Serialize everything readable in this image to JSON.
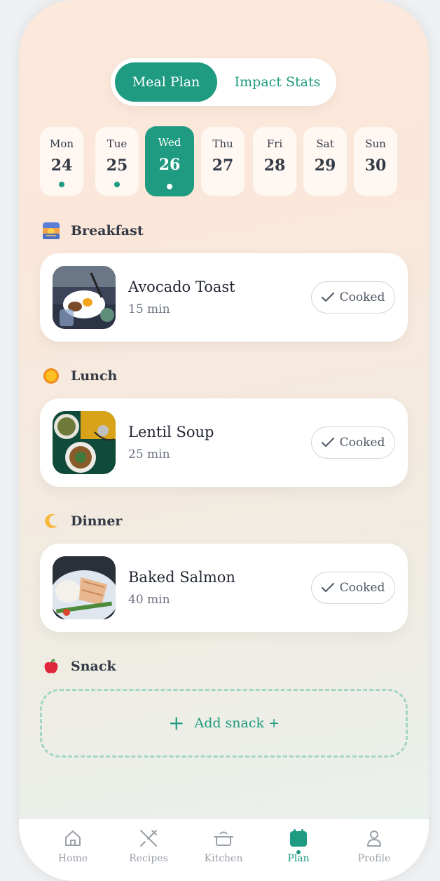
{
  "tabs": {
    "meal_plan": "Meal Plan",
    "impact_stats": "Impact Stats"
  },
  "days": [
    {
      "name": "Mon",
      "num": "24",
      "dot": true
    },
    {
      "name": "Tue",
      "num": "25",
      "dot": true
    },
    {
      "name": "Wed",
      "num": "26",
      "dot": true,
      "active": true
    },
    {
      "name": "Thu",
      "num": "27",
      "dot": false
    },
    {
      "name": "Fri",
      "num": "28",
      "dot": false
    },
    {
      "name": "Sat",
      "num": "29",
      "dot": false
    },
    {
      "name": "Sun",
      "num": "30",
      "dot": false
    }
  ],
  "sections": {
    "breakfast": {
      "label": "Breakfast",
      "icon": "sunrise-icon"
    },
    "lunch": {
      "label": "Lunch",
      "icon": "sun-icon"
    },
    "dinner": {
      "label": "Dinner",
      "icon": "crescent-moon-icon"
    },
    "snack": {
      "label": "Snack",
      "icon": "apple-icon"
    }
  },
  "meals": {
    "breakfast": {
      "name": "Avocado Toast",
      "time": "15 min",
      "action": "Cooked"
    },
    "lunch": {
      "name": "Lentil Soup",
      "time": "25 min",
      "action": "Cooked"
    },
    "dinner": {
      "name": "Baked Salmon",
      "time": "40 min",
      "action": "Cooked"
    }
  },
  "add_snack": "Add snack +",
  "nav": {
    "home": "Home",
    "recipes": "Recipes",
    "kitchen": "Kitchen",
    "plan": "Plan",
    "profile": "Profile"
  },
  "colors": {
    "accent": "#1e9b80",
    "text": "#333a45",
    "muted": "#9aa0a8"
  }
}
